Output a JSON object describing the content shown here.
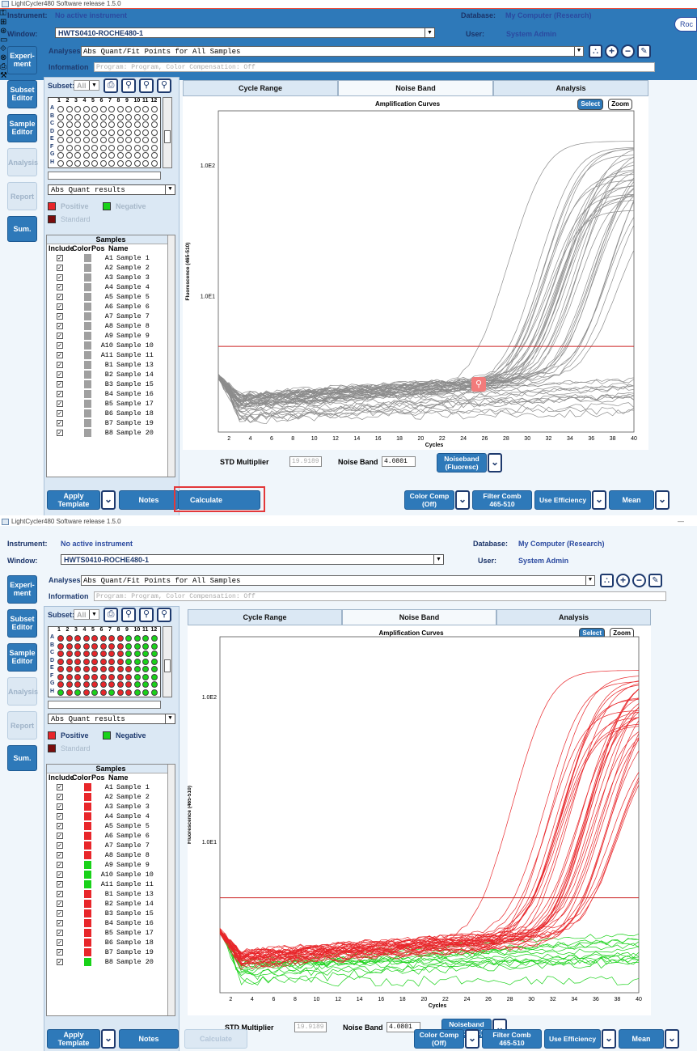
{
  "screens": [
    {
      "titlebar": {
        "app": "LightCycler480 Software release 1.5.0"
      },
      "instrument": {
        "label": "Instrument:",
        "value": "No active instrument"
      },
      "database": {
        "label": "Database:",
        "value": "My Computer (Research)"
      },
      "window": {
        "label": "Window:",
        "value": "HWTS0410-ROCHE480-1"
      },
      "user": {
        "label": "User:",
        "value": "System Admin"
      },
      "brand": "Roc",
      "state": "before-calculate"
    },
    {
      "titlebar": {
        "app": "LightCycler480 Software release 1.5.0"
      },
      "instrument": {
        "label": "Instrument:",
        "value": "No active instrument"
      },
      "database": {
        "label": "Database:",
        "value": "My Computer (Research)"
      },
      "window": {
        "label": "Window:",
        "value": "HWTS0410-ROCHE480-1"
      },
      "user": {
        "label": "User:",
        "value": "System Admin"
      },
      "state": "after-calculate"
    }
  ],
  "nav": {
    "experiment": "Experi-\nment",
    "subset": "Subset\nEditor",
    "sample": "Sample\nEditor",
    "analysis": "Analysis",
    "report": "Report",
    "sum": "Sum."
  },
  "analyses": {
    "label": "Analyses",
    "value": "Abs Quant/Fit Points for All Samples"
  },
  "information": {
    "label": "Information",
    "value": "Program: Program, Color Compensation: Off"
  },
  "subset": {
    "label": "Subset:",
    "value": "All"
  },
  "plate": {
    "rows": [
      "A",
      "B",
      "C",
      "D",
      "E",
      "F",
      "G",
      "H"
    ],
    "cols": [
      "1",
      "2",
      "3",
      "4",
      "5",
      "6",
      "7",
      "8",
      "9",
      "10",
      "11",
      "12"
    ]
  },
  "results_select": "Abs Quant results",
  "legend": {
    "positive": "Positive",
    "negative": "Negative",
    "standard": "Standard",
    "positive_color": "#e8262a",
    "negative_color": "#19d219",
    "standard_color": "#7a0d0d",
    "neutral_color": "#a0a0a0"
  },
  "samples_table": {
    "title": "Samples",
    "headers": [
      "Include",
      "Color",
      "Pos",
      "Name"
    ],
    "rows": [
      {
        "pos": "A1",
        "name": "Sample 1",
        "result": "positive"
      },
      {
        "pos": "A2",
        "name": "Sample 2",
        "result": "positive"
      },
      {
        "pos": "A3",
        "name": "Sample 3",
        "result": "positive"
      },
      {
        "pos": "A4",
        "name": "Sample 4",
        "result": "positive"
      },
      {
        "pos": "A5",
        "name": "Sample 5",
        "result": "positive"
      },
      {
        "pos": "A6",
        "name": "Sample 6",
        "result": "positive"
      },
      {
        "pos": "A7",
        "name": "Sample 7",
        "result": "positive"
      },
      {
        "pos": "A8",
        "name": "Sample 8",
        "result": "positive"
      },
      {
        "pos": "A9",
        "name": "Sample 9",
        "result": "negative"
      },
      {
        "pos": "A10",
        "name": "Sample 10",
        "result": "negative"
      },
      {
        "pos": "A11",
        "name": "Sample 11",
        "result": "negative"
      },
      {
        "pos": "B1",
        "name": "Sample 13",
        "result": "positive"
      },
      {
        "pos": "B2",
        "name": "Sample 14",
        "result": "positive"
      },
      {
        "pos": "B3",
        "name": "Sample 15",
        "result": "positive"
      },
      {
        "pos": "B4",
        "name": "Sample 16",
        "result": "positive"
      },
      {
        "pos": "B5",
        "name": "Sample 17",
        "result": "positive"
      },
      {
        "pos": "B6",
        "name": "Sample 18",
        "result": "positive"
      },
      {
        "pos": "B7",
        "name": "Sample 19",
        "result": "positive"
      },
      {
        "pos": "B8",
        "name": "Sample 20",
        "result": "negative"
      }
    ]
  },
  "tabs": [
    "Cycle Range",
    "Noise Band",
    "Analysis"
  ],
  "active_tab": "Noise Band",
  "chart_controls": {
    "select": "Select",
    "zoom": "Zoom"
  },
  "chart_data": {
    "type": "line",
    "title": "Amplification Curves",
    "xlabel": "Cycles",
    "ylabel": "Fluorescence (465-510)",
    "xlim": [
      1,
      40
    ],
    "x_ticks": [
      2,
      4,
      6,
      8,
      10,
      12,
      14,
      16,
      18,
      20,
      22,
      24,
      26,
      28,
      30,
      32,
      34,
      36,
      38,
      40
    ],
    "y_scale": "log",
    "y_tick_labels": [
      "1.0E2",
      "1.0E1"
    ],
    "noise_band_line": "horizontal red threshold line",
    "series_groups": [
      {
        "group": "positive",
        "count": 34,
        "start_fluor": 2.5,
        "baseline": 1.5,
        "ct_range": [
          30,
          37
        ],
        "plateau_range": [
          40,
          140
        ]
      },
      {
        "group": "negative",
        "count": 14,
        "start_fluor": 2.5,
        "baseline": 1.2,
        "drift": 0.6
      }
    ]
  },
  "noise": {
    "std_label": "STD Multiplier",
    "std_value": "19.9189",
    "band_label": "Noise Band",
    "band_value": "4.0801",
    "noiseband_btn": "Noiseband\n(Fluoresc)"
  },
  "bottom": {
    "apply": "Apply\nTemplate",
    "notes": "Notes",
    "calculate": "Calculate",
    "colorcomp": "Color Comp\n(Off)",
    "filter": "Filter Comb\n465-510",
    "efficiency": "Use Efficiency",
    "mean": "Mean"
  },
  "icons": {
    "chevron": "chevron-down-icon",
    "zoom": "magnifier-icon"
  }
}
